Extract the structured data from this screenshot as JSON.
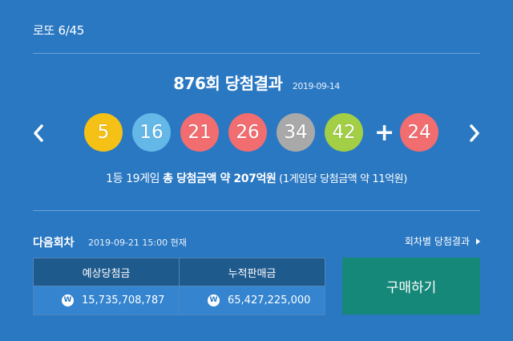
{
  "game_name": "로또 6/45",
  "draw": {
    "round_title": "876회 당첨결과",
    "date": "2019-09-14"
  },
  "numbers": [
    {
      "value": "5",
      "color": "#f5c116"
    },
    {
      "value": "16",
      "color": "#64b8e8"
    },
    {
      "value": "21",
      "color": "#f26d70"
    },
    {
      "value": "26",
      "color": "#f26d70"
    },
    {
      "value": "34",
      "color": "#a9a9a9"
    },
    {
      "value": "42",
      "color": "#a2cf45"
    }
  ],
  "plus_symbol": "+",
  "bonus": {
    "value": "24",
    "color": "#f26d70"
  },
  "summary": {
    "pre": "1등 19게임 ",
    "mid": "총 당첨금액 약 207억원",
    "post": " (1게임당 당첨금액 약 11억원)"
  },
  "next": {
    "label": "다음회차",
    "date": "2019-09-21 15:00 현재"
  },
  "by_round_link": "회차별 당첨결과",
  "table": {
    "headers": [
      "예상당첨금",
      "누적판매금"
    ],
    "won_symbol": "W",
    "values": [
      "15,735,708,787",
      "65,427,225,000"
    ]
  },
  "buy_button": "구매하기",
  "icons": {
    "prev": "chevron-left-icon",
    "next": "chevron-right-icon"
  }
}
